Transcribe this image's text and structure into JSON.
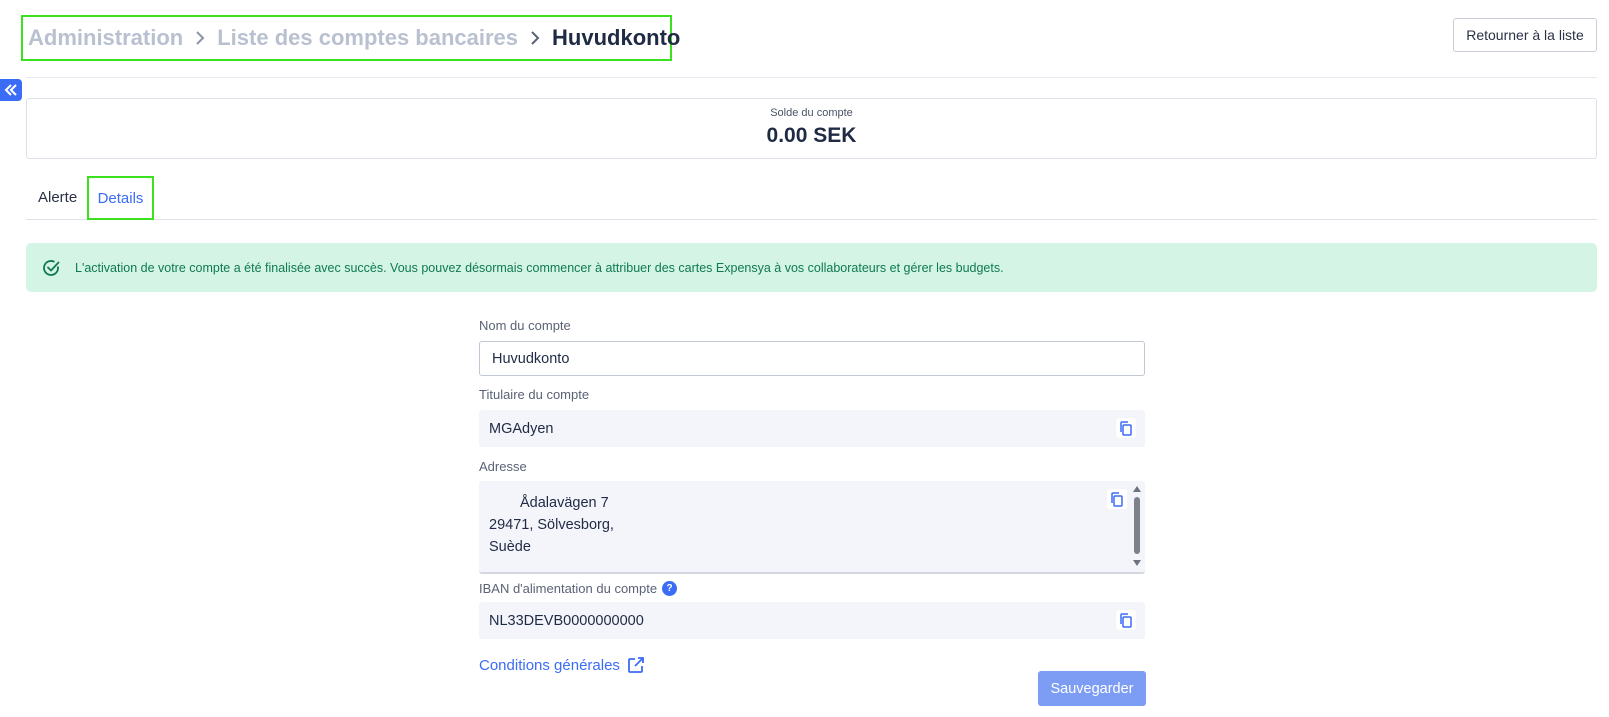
{
  "breadcrumb": {
    "items": [
      "Administration",
      "Liste des comptes bancaires"
    ],
    "current": "Huvudkonto"
  },
  "header": {
    "back_label": "Retourner à la liste"
  },
  "balance": {
    "label": "Solde du compte",
    "value": "0.00 SEK"
  },
  "tabs": [
    {
      "label": "Alerte",
      "active": false
    },
    {
      "label": "Details",
      "active": true
    }
  ],
  "alert": {
    "message": "L'activation de votre compte a été finalisée avec succès. Vous pouvez désormais commencer à attribuer des cartes Expensya à vos collaborateurs et gérer les budgets."
  },
  "form": {
    "account_name": {
      "label": "Nom du compte",
      "value": "Huvudkonto"
    },
    "account_holder": {
      "label": "Titulaire du compte",
      "value": "MGAdyen"
    },
    "address": {
      "label": "Adresse",
      "lines": [
        "Ådalavägen 7",
        "29471, Sölvesborg,",
        "Suède"
      ]
    },
    "iban": {
      "label": "IBAN d'alimentation du compte",
      "value": "NL33DEVB0000000000"
    },
    "terms_label": "Conditions générales",
    "save_label": "Sauvegarder"
  },
  "colors": {
    "accent": "#3b6cf6",
    "success_bg": "#d4f4e6",
    "success_text": "#0f7a50",
    "highlight": "#39e11f"
  },
  "icons": [
    "chevron-right-icon",
    "double-chevron-left-icon",
    "check-circle-icon",
    "copy-icon",
    "help-icon",
    "external-link-icon"
  ]
}
